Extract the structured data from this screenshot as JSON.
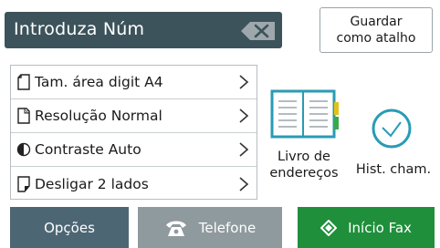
{
  "header": {
    "number_field_label": "Introduza Núm",
    "shortcut_label_line1": "Guardar",
    "shortcut_label_line2": "como atalho"
  },
  "settings": [
    {
      "icon": "page-size-icon",
      "label": "Tam. área digit A4"
    },
    {
      "icon": "resolution-icon",
      "label": "Resolução Normal"
    },
    {
      "icon": "contrast-icon",
      "label": "Contraste Auto"
    },
    {
      "icon": "duplex-icon",
      "label": "Desligar 2 lados"
    }
  ],
  "quick_actions": {
    "address_book_line1": "Livro de",
    "address_book_line2": "endereços",
    "call_history": "Hist. cham."
  },
  "bottom_bar": {
    "options": "Opções",
    "phone": "Telefone",
    "start_fax": "Início Fax"
  },
  "colors": {
    "field_bg": "#3d535b",
    "options_bg": "#4d6674",
    "phone_bg": "#8f9a9e",
    "fax_bg": "#1f8f3b",
    "accent_teal": "#2a9bb5"
  }
}
